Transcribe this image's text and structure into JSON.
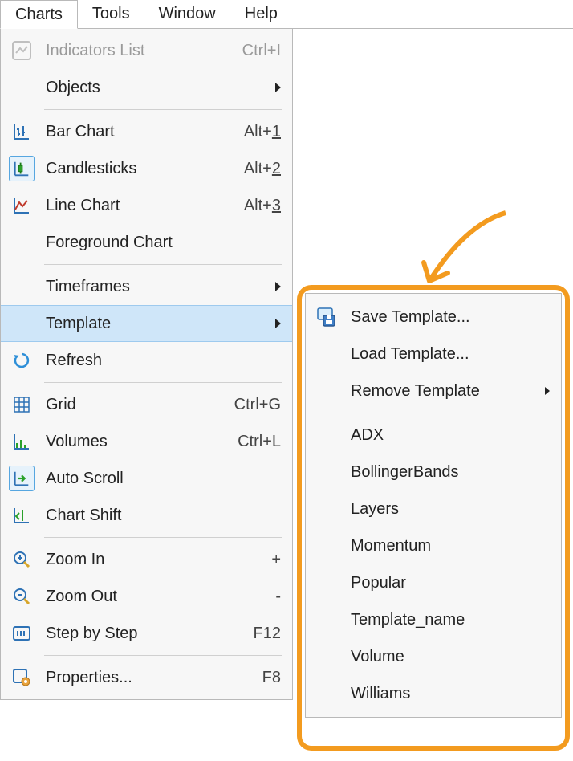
{
  "menubar": {
    "items": [
      {
        "label": "Charts",
        "active": true
      },
      {
        "label": "Tools"
      },
      {
        "label": "Window"
      },
      {
        "label": "Help"
      }
    ]
  },
  "dropdown": {
    "items": [
      {
        "icon": "indicators-icon",
        "label": "Indicators List",
        "shortcut": "Ctrl+I",
        "disabled": true
      },
      {
        "icon": "",
        "label": "Objects",
        "submenu": true
      },
      "sep",
      {
        "icon": "bar-chart-icon",
        "label": "Bar Chart",
        "shortcut_prefix": "Alt+",
        "shortcut_u": "1"
      },
      {
        "icon": "candlestick-icon",
        "label": "Candlesticks",
        "shortcut_prefix": "Alt+",
        "shortcut_u": "2",
        "boxed": true
      },
      {
        "icon": "line-chart-icon",
        "label": "Line Chart",
        "shortcut_prefix": "Alt+",
        "shortcut_u": "3"
      },
      {
        "icon": "",
        "label": "Foreground Chart"
      },
      "sep",
      {
        "icon": "",
        "label": "Timeframes",
        "submenu": true
      },
      {
        "icon": "",
        "label": "Template",
        "submenu": true,
        "highlight": true
      },
      {
        "icon": "refresh-icon",
        "label": "Refresh"
      },
      "sep",
      {
        "icon": "grid-icon",
        "label": "Grid",
        "shortcut": "Ctrl+G"
      },
      {
        "icon": "volumes-icon",
        "label": "Volumes",
        "shortcut": "Ctrl+L"
      },
      {
        "icon": "autoscroll-icon",
        "label": "Auto Scroll",
        "boxed": true
      },
      {
        "icon": "chartshift-icon",
        "label": "Chart Shift"
      },
      "sep",
      {
        "icon": "zoomin-icon",
        "label": "Zoom In",
        "shortcut": "+"
      },
      {
        "icon": "zoomout-icon",
        "label": "Zoom Out",
        "shortcut": "-"
      },
      {
        "icon": "step-icon",
        "label": "Step by Step",
        "shortcut": "F12"
      },
      "sep",
      {
        "icon": "properties-icon",
        "label": "Properties...",
        "shortcut": "F8"
      }
    ]
  },
  "submenu": {
    "items": [
      {
        "icon": "save-template-icon",
        "label": "Save Template..."
      },
      {
        "icon": "",
        "label": "Load Template..."
      },
      {
        "icon": "",
        "label": "Remove Template",
        "submenu": true
      },
      "sep",
      {
        "icon": "",
        "label": "ADX"
      },
      {
        "icon": "",
        "label": "BollingerBands"
      },
      {
        "icon": "",
        "label": "Layers"
      },
      {
        "icon": "",
        "label": "Momentum"
      },
      {
        "icon": "",
        "label": "Popular"
      },
      {
        "icon": "",
        "label": "Template_name"
      },
      {
        "icon": "",
        "label": "Volume"
      },
      {
        "icon": "",
        "label": "Williams"
      }
    ]
  }
}
